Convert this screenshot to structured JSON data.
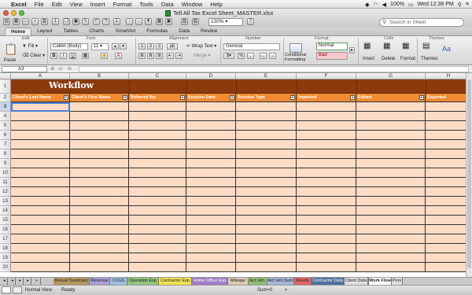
{
  "menubar": {
    "app": "Excel",
    "items": [
      "File",
      "Edit",
      "View",
      "Insert",
      "Format",
      "Tools",
      "Data",
      "Window",
      "Help"
    ],
    "battery": "100%",
    "clock": "Wed 12:38 PM"
  },
  "window": {
    "title": "Tell All Tax Excel Sheet_MASTER.xlsx",
    "zoom": "130%",
    "search_placeholder": "Search in Sheet"
  },
  "ribbon": {
    "tabs": [
      "Home",
      "Layout",
      "Tables",
      "Charts",
      "SmartArt",
      "Formulas",
      "Data",
      "Review"
    ],
    "groups": {
      "edit": "Edit",
      "font": "Font",
      "alignment": "Alignment",
      "number": "Number",
      "format": "Format",
      "cells": "Cells",
      "themes": "Themes"
    },
    "paste": "Paste",
    "fill": "Fill",
    "clear": "Clear",
    "font_name": "Calibri (Body)",
    "font_size": "11",
    "wrap_text": "Wrap Text",
    "merge": "Merge",
    "number_format": "General",
    "cond_format_1": "Conditional",
    "cond_format_2": "Formatting",
    "style_normal": "Normal",
    "style_bad": "Bad",
    "insert": "Insert",
    "delete": "Delete",
    "format_btn": "Format",
    "themes_btn": "Themes",
    "bold": "B",
    "italic": "I",
    "underline": "U",
    "percent": "%",
    "comma": ",",
    "fontcolor": "A",
    "aa": "Aa"
  },
  "formula_bar": {
    "cell_ref": "A3",
    "fx": "fx",
    "value": ""
  },
  "sheet": {
    "columns": [
      "A",
      "B",
      "C",
      "D",
      "E",
      "F",
      "G",
      "H"
    ],
    "title": "Workflow",
    "headers": [
      "Client's Last Name",
      "Client's First Name",
      "Referred By:",
      "Session Date:",
      "Session Type",
      "Imported",
      "Edited:",
      "Exported"
    ],
    "rows": [
      "1",
      "2",
      "3",
      "4",
      "5",
      "6",
      "7",
      "8",
      "9",
      "10",
      "11",
      "12",
      "13",
      "14",
      "15",
      "16",
      "17",
      "18",
      "19",
      "20"
    ]
  },
  "sheet_tabs": [
    {
      "label": "Annual Summary",
      "color": "#b5975e"
    },
    {
      "label": "Revenue",
      "color": "#a99fd6"
    },
    {
      "label": "COGS",
      "color": "#9fc1e6"
    },
    {
      "label": "Operation Exp",
      "color": "#93c47d"
    },
    {
      "label": "Contractor Exp",
      "color": "#f2e14f"
    },
    {
      "label": "Home Office Exp",
      "color": "#a07cc7"
    },
    {
      "label": "Mileage",
      "color": "#dccbb0"
    },
    {
      "label": "Act.Veh.",
      "color": "#8fbf72"
    },
    {
      "label": "Act.Veh.Sum",
      "color": "#a7b7d8"
    },
    {
      "label": "Assets",
      "color": "#e06666"
    },
    {
      "label": "Contractor Data",
      "color": "#4f6f9e"
    },
    {
      "label": "Client Data",
      "color": "#dedede"
    },
    {
      "label": "Work Flow",
      "color": "#ffffff"
    },
    {
      "label": "Pers",
      "color": "#dedede"
    }
  ],
  "status": {
    "view": "Normal View",
    "ready": "Ready",
    "sum": "Sum=0"
  },
  "colors": {
    "title_bg": "#8b3a0e",
    "header_bg": "#f08b33",
    "row_bg": "#fcdcc4"
  }
}
